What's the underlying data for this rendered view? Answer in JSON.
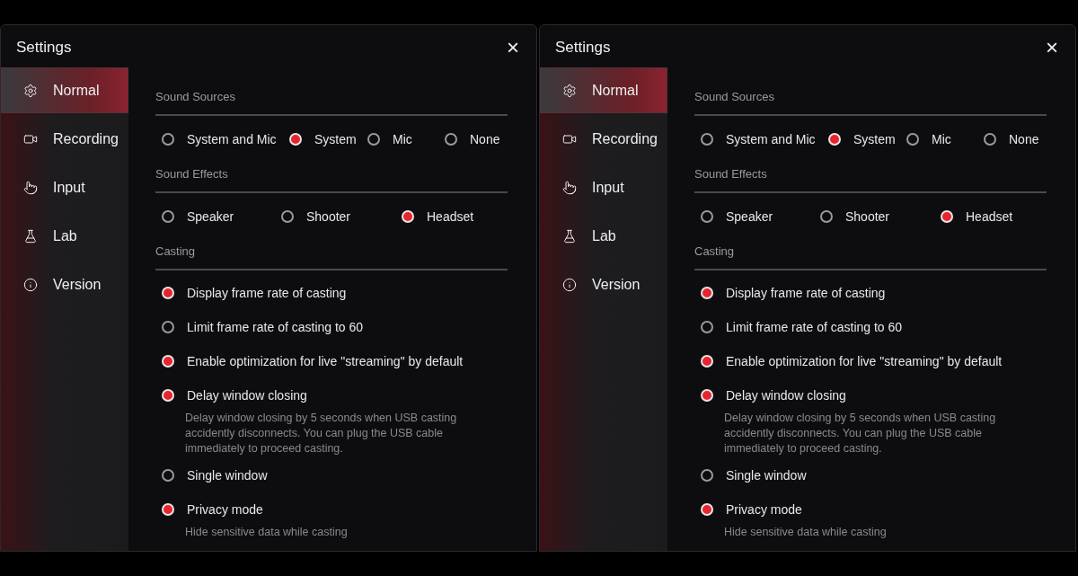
{
  "panels": [
    {
      "title": "Settings",
      "close": "×",
      "nav": [
        {
          "label": "Normal",
          "selected": true
        },
        {
          "label": "Recording",
          "selected": false
        },
        {
          "label": "Input",
          "selected": false
        },
        {
          "label": "Lab",
          "selected": false
        },
        {
          "label": "Version",
          "selected": false
        }
      ],
      "sound_sources": {
        "title": "Sound Sources",
        "options": [
          {
            "label": "System and Mic",
            "selected": false
          },
          {
            "label": "System",
            "selected": true
          },
          {
            "label": "Mic",
            "selected": false
          },
          {
            "label": "None",
            "selected": false
          }
        ]
      },
      "sound_effects": {
        "title": "Sound Effects",
        "options": [
          {
            "label": "Speaker",
            "selected": false
          },
          {
            "label": "Shooter",
            "selected": false
          },
          {
            "label": "Headset",
            "selected": true
          }
        ]
      },
      "casting": {
        "title": "Casting",
        "options": [
          {
            "label": "Display frame rate of casting",
            "checked": true
          },
          {
            "label": "Limit frame rate of casting to 60",
            "checked": false
          },
          {
            "label": "Enable optimization for live \"streaming\" by default",
            "checked": true
          },
          {
            "label": "Delay window closing",
            "checked": true,
            "description": "Delay window closing by 5 seconds when USB casting accidently disconnects. You can plug the USB cable immediately to proceed casting."
          },
          {
            "label": "Single window",
            "checked": false
          },
          {
            "label": "Privacy mode",
            "checked": true,
            "description": "Hide sensitive data while casting"
          }
        ]
      }
    },
    {
      "title": "Settings",
      "close": "×",
      "nav": [
        {
          "label": "Normal",
          "selected": true
        },
        {
          "label": "Recording",
          "selected": false
        },
        {
          "label": "Input",
          "selected": false
        },
        {
          "label": "Lab",
          "selected": false
        },
        {
          "label": "Version",
          "selected": false
        }
      ],
      "sound_sources": {
        "title": "Sound Sources",
        "options": [
          {
            "label": "System and Mic",
            "selected": false
          },
          {
            "label": "System",
            "selected": true
          },
          {
            "label": "Mic",
            "selected": false
          },
          {
            "label": "None",
            "selected": false
          }
        ]
      },
      "sound_effects": {
        "title": "Sound Effects",
        "options": [
          {
            "label": "Speaker",
            "selected": false
          },
          {
            "label": "Shooter",
            "selected": false
          },
          {
            "label": "Headset",
            "selected": true
          }
        ]
      },
      "casting": {
        "title": "Casting",
        "options": [
          {
            "label": "Display frame rate of casting",
            "checked": true
          },
          {
            "label": "Limit frame rate of casting to 60",
            "checked": false
          },
          {
            "label": "Enable optimization for live \"streaming\" by default",
            "checked": true
          },
          {
            "label": "Delay window closing",
            "checked": true,
            "description": "Delay window closing by 5 seconds when USB casting accidently disconnects. You can plug the USB cable immediately to proceed casting."
          },
          {
            "label": "Single window",
            "checked": false
          },
          {
            "label": "Privacy mode",
            "checked": true,
            "description": "Hide sensitive data while casting"
          }
        ]
      }
    }
  ]
}
